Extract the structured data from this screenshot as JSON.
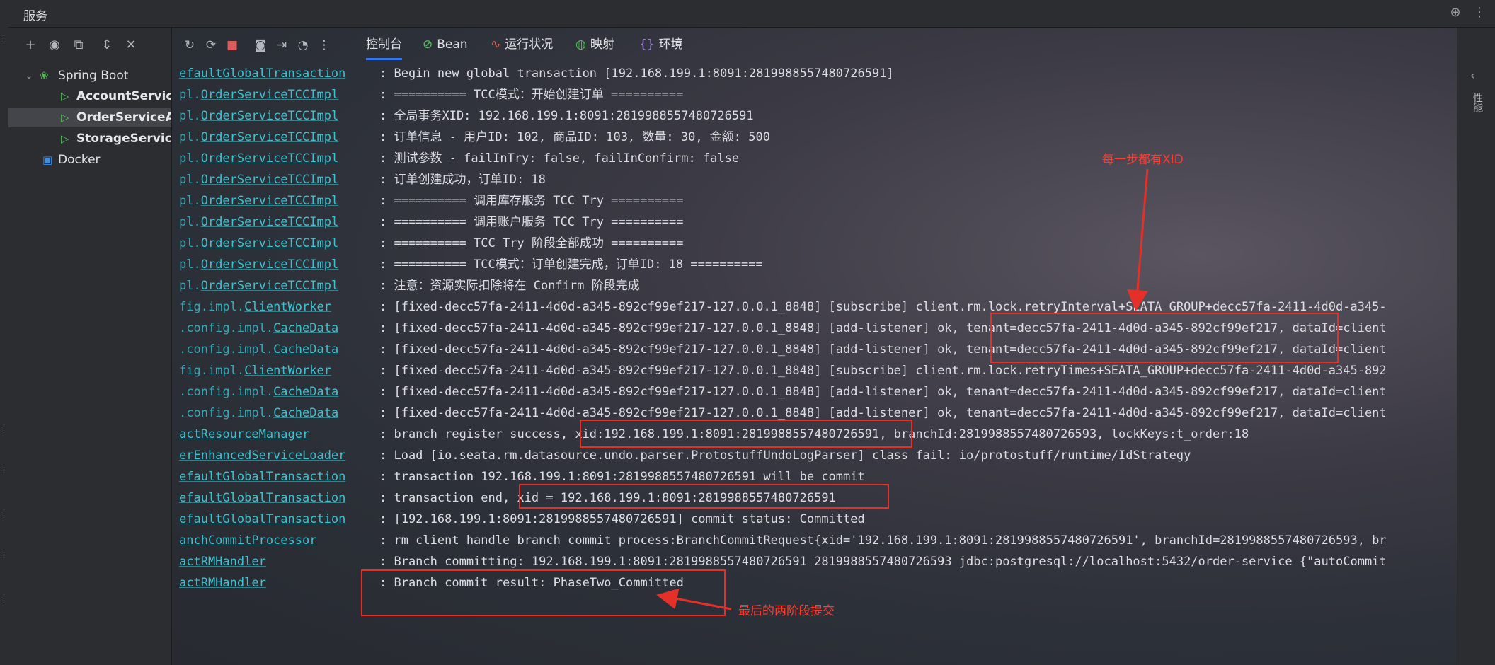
{
  "window": {
    "title": "服务"
  },
  "tree": {
    "items": [
      {
        "label": "Spring Boot"
      },
      {
        "label": "AccountServiceA"
      },
      {
        "label": "OrderServiceApp"
      },
      {
        "label": "StorageServiceA"
      },
      {
        "label": "Docker"
      }
    ]
  },
  "console_tabs": [
    {
      "label": "控制台"
    },
    {
      "label": "Bean"
    },
    {
      "label": "运行状况"
    },
    {
      "label": "映射"
    },
    {
      "label": "环境"
    }
  ],
  "log": [
    {
      "pkg": "",
      "cls": "efaultGlobalTransaction",
      "msg": ": Begin new global transaction [192.168.199.1:8091:2819988557480726591]"
    },
    {
      "pkg": "pl.",
      "cls": "OrderServiceTCCImpl",
      "msg": ": ========== TCC模式：开始创建订单 =========="
    },
    {
      "pkg": "pl.",
      "cls": "OrderServiceTCCImpl",
      "msg": ": 全局事务XID: 192.168.199.1:8091:2819988557480726591"
    },
    {
      "pkg": "pl.",
      "cls": "OrderServiceTCCImpl",
      "msg": ": 订单信息 - 用户ID: 102, 商品ID: 103, 数量: 30, 金额: 500"
    },
    {
      "pkg": "pl.",
      "cls": "OrderServiceTCCImpl",
      "msg": ": 测试参数 - failInTry: false, failInConfirm: false"
    },
    {
      "pkg": "pl.",
      "cls": "OrderServiceTCCImpl",
      "msg": ": 订单创建成功，订单ID: 18"
    },
    {
      "pkg": "pl.",
      "cls": "OrderServiceTCCImpl",
      "msg": ": ========== 调用库存服务 TCC Try =========="
    },
    {
      "pkg": "pl.",
      "cls": "OrderServiceTCCImpl",
      "msg": ": ========== 调用账户服务 TCC Try =========="
    },
    {
      "pkg": "pl.",
      "cls": "OrderServiceTCCImpl",
      "msg": ": ========== TCC Try 阶段全部成功 =========="
    },
    {
      "pkg": "pl.",
      "cls": "OrderServiceTCCImpl",
      "msg": ": ========== TCC模式：订单创建完成，订单ID: 18 =========="
    },
    {
      "pkg": "pl.",
      "cls": "OrderServiceTCCImpl",
      "msg": ": 注意：资源实际扣除将在 Confirm 阶段完成"
    },
    {
      "pkg": "fig.impl.",
      "cls": "ClientWorker",
      "msg": ": [fixed-decc57fa-2411-4d0d-a345-892cf99ef217-127.0.0.1_8848] [subscribe] client.rm.lock.retryInterval+SEATA_GROUP+decc57fa-2411-4d0d-a345-"
    },
    {
      "pkg": ".config.impl.",
      "cls": "CacheData",
      "msg": ": [fixed-decc57fa-2411-4d0d-a345-892cf99ef217-127.0.0.1_8848] [add-listener] ok, tenant=decc57fa-2411-4d0d-a345-892cf99ef217, dataId=client"
    },
    {
      "pkg": ".config.impl.",
      "cls": "CacheData",
      "msg": ": [fixed-decc57fa-2411-4d0d-a345-892cf99ef217-127.0.0.1_8848] [add-listener] ok, tenant=decc57fa-2411-4d0d-a345-892cf99ef217, dataId=client"
    },
    {
      "pkg": "fig.impl.",
      "cls": "ClientWorker",
      "msg": ": [fixed-decc57fa-2411-4d0d-a345-892cf99ef217-127.0.0.1_8848] [subscribe] client.rm.lock.retryTimes+SEATA_GROUP+decc57fa-2411-4d0d-a345-892"
    },
    {
      "pkg": ".config.impl.",
      "cls": "CacheData",
      "msg": ": [fixed-decc57fa-2411-4d0d-a345-892cf99ef217-127.0.0.1_8848] [add-listener] ok, tenant=decc57fa-2411-4d0d-a345-892cf99ef217, dataId=client"
    },
    {
      "pkg": ".config.impl.",
      "cls": "CacheData",
      "msg": ": [fixed-decc57fa-2411-4d0d-a345-892cf99ef217-127.0.0.1_8848] [add-listener] ok, tenant=decc57fa-2411-4d0d-a345-892cf99ef217, dataId=client"
    },
    {
      "pkg": "",
      "cls": "actResourceManager",
      "msg": ": branch register success, xid:192.168.199.1:8091:2819988557480726591, branchId:2819988557480726593, lockKeys:t_order:18"
    },
    {
      "pkg": "",
      "cls": "erEnhancedServiceLoader",
      "msg": ": Load [io.seata.rm.datasource.undo.parser.ProtostuffUndoLogParser] class fail: io/protostuff/runtime/IdStrategy"
    },
    {
      "pkg": "",
      "cls": "efaultGlobalTransaction",
      "msg": ": transaction 192.168.199.1:8091:2819988557480726591 will be commit"
    },
    {
      "pkg": "",
      "cls": "efaultGlobalTransaction",
      "msg": ": transaction end, xid = 192.168.199.1:8091:2819988557480726591"
    },
    {
      "pkg": "",
      "cls": "efaultGlobalTransaction",
      "msg": ": [192.168.199.1:8091:2819988557480726591] commit status: Committed"
    },
    {
      "pkg": "",
      "cls": "anchCommitProcessor",
      "msg": ": rm client handle branch commit process:BranchCommitRequest{xid='192.168.199.1:8091:2819988557480726591', branchId=2819988557480726593, br"
    },
    {
      "pkg": "",
      "cls": "actRMHandler",
      "msg": ": Branch committing: 192.168.199.1:8091:2819988557480726591 2819988557480726593 jdbc:postgresql://localhost:5432/order-service {\"autoCommit"
    },
    {
      "pkg": "",
      "cls": "actRMHandler",
      "msg": ": Branch commit result: PhaseTwo_Committed"
    }
  ],
  "annotations": {
    "xid_note": "每一步都有XID",
    "commit_note": "最后的两阶段提交"
  },
  "right_panel": {
    "label": "性能"
  },
  "colors": {
    "accent": "#3574f0",
    "annotation": "#e5302a",
    "log_class": "#3fc2d0",
    "run_green": "#4fbf55",
    "stop_red": "#db5c5c"
  }
}
